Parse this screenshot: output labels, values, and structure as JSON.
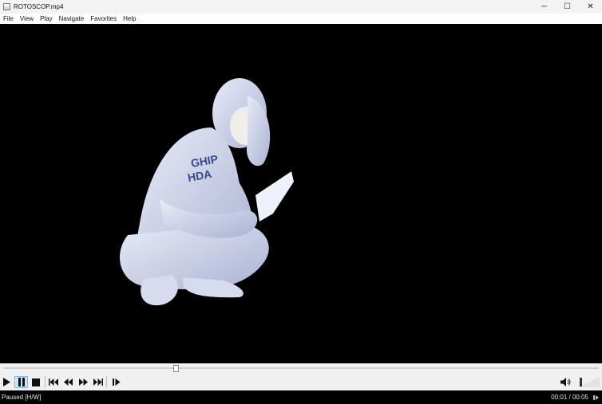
{
  "window": {
    "title": "ROTOSCOP.mp4",
    "minimize_glyph": "─",
    "maximize_glyph": "☐",
    "close_glyph": "✕"
  },
  "menu": [
    "File",
    "View",
    "Play",
    "Navigate",
    "Favorites",
    "Help"
  ],
  "player": {
    "seek_position_fraction": 0.29,
    "volume_fraction": 0.0
  },
  "status": {
    "state": "Paused [H/W]",
    "time": "00:01 / 00:05"
  },
  "icons": {
    "play": "play-icon",
    "pause": "pause-icon",
    "stop": "stop-icon",
    "skip_back": "skip-back-icon",
    "rewind": "rewind-icon",
    "fast_forward": "fast-forward-icon",
    "skip_forward": "skip-forward-icon",
    "frame_step": "frame-step-icon",
    "volume": "volume-icon",
    "stats": "stats-icon"
  }
}
